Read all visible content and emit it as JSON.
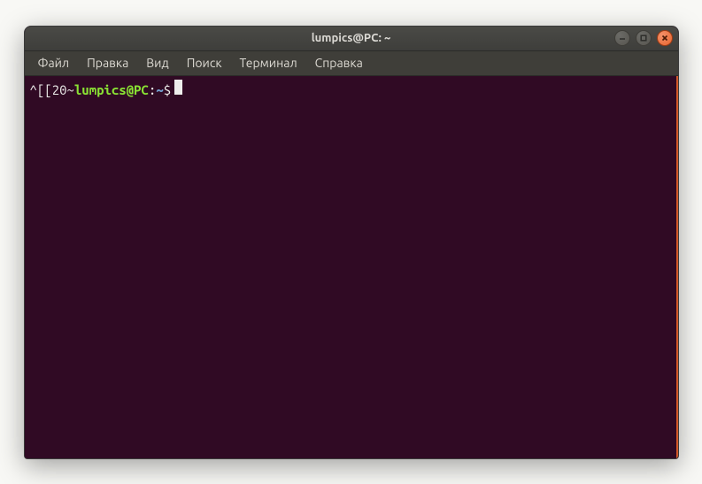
{
  "window": {
    "title": "lumpics@PC: ~"
  },
  "menubar": {
    "items": [
      "Файл",
      "Правка",
      "Вид",
      "Поиск",
      "Терминал",
      "Справка"
    ]
  },
  "prompt": {
    "prefix": "^[[20~",
    "user_host": "lumpics@PC",
    "separator": ":",
    "path": "~",
    "symbol": "$"
  }
}
